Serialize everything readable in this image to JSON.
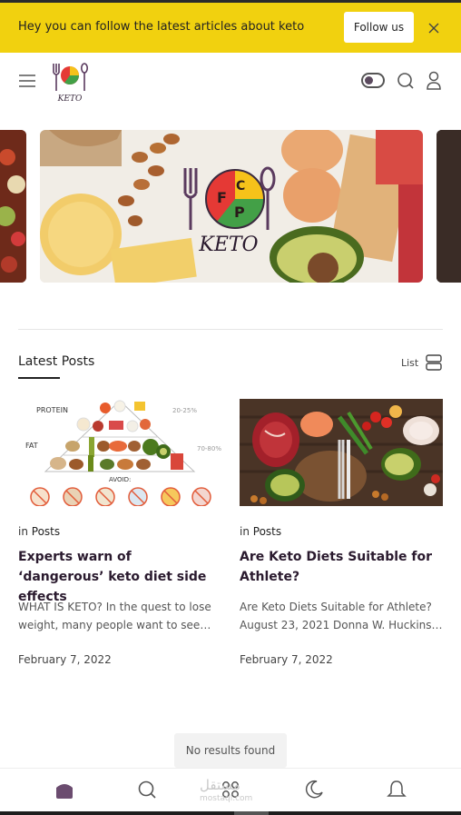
{
  "promo": {
    "text": "Hey you can follow the latest articles about keto",
    "follow_label": "Follow us"
  },
  "header": {
    "logo_text": "KETO",
    "logo_letters": [
      "F",
      "C",
      "P"
    ]
  },
  "hero": {
    "logo_text": "KETO"
  },
  "latest": {
    "title": "Latest Posts",
    "view_label": "List"
  },
  "posts": [
    {
      "in_label": "in",
      "category": "Posts",
      "title": "Experts warn of ‘dangerous’ keto diet side effects",
      "excerpt": "WHAT IS KETO? In the quest to lose weight, many people want to see…",
      "date": "February 7, 2022",
      "image_labels": {
        "protein": "PROTEIN",
        "fat": "FAT",
        "avoid": "AVOID:",
        "pct1": "20-25%",
        "pct2": "70-80%"
      }
    },
    {
      "in_label": "in",
      "category": "Posts",
      "title": "Are Keto Diets Suitable for Athlete?",
      "excerpt": "Are Keto Diets Suitable for Athlete? August 23, 2021 Donna W. Huckins…",
      "date": "February 7, 2022"
    }
  ],
  "status": {
    "no_results": "No results found"
  },
  "bottom_nav": {
    "watermark_top": "مستقل",
    "watermark_bottom": "mostaql.com"
  },
  "colors": {
    "promo_bg": "#f1d10f",
    "accent": "#6b4c6f",
    "text": "#2a1a2e"
  }
}
